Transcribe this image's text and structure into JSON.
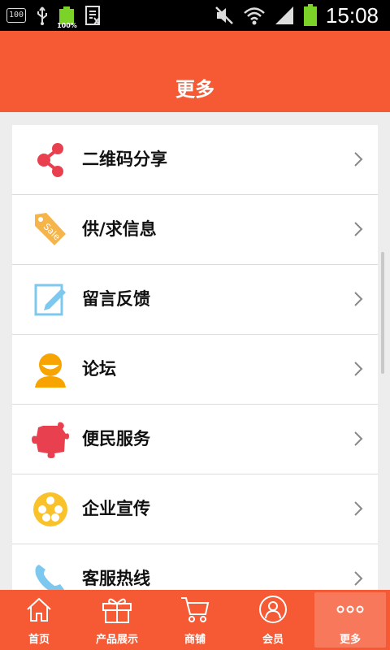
{
  "status_bar": {
    "notif_box": "100",
    "battery_small_pct": "100%",
    "time": "15:08"
  },
  "header": {
    "title": "更多"
  },
  "menu": {
    "items": [
      {
        "label": "二维码分享",
        "icon": "share-icon"
      },
      {
        "label": "供/求信息",
        "icon": "sale-tag-icon",
        "icon_text": "Sale"
      },
      {
        "label": "留言反馈",
        "icon": "edit-note-icon"
      },
      {
        "label": "论坛",
        "icon": "user-avatar-icon"
      },
      {
        "label": "便民服务",
        "icon": "puzzle-icon"
      },
      {
        "label": "企业宣传",
        "icon": "film-reel-icon"
      },
      {
        "label": "客服热线",
        "icon": "phone-icon"
      }
    ]
  },
  "tabbar": {
    "items": [
      {
        "label": "首页",
        "icon": "home-icon"
      },
      {
        "label": "产品展示",
        "icon": "gift-icon"
      },
      {
        "label": "商铺",
        "icon": "cart-icon"
      },
      {
        "label": "会员",
        "icon": "member-icon"
      },
      {
        "label": "更多",
        "icon": "more-dots-icon",
        "active": true
      }
    ]
  },
  "colors": {
    "accent": "#f55a35",
    "active_tab": "#f7785a",
    "share": "#e8404f",
    "sale": "#f6b54a",
    "edit": "#7cc8ee",
    "avatar": "#f8a400",
    "puzzle": "#e8404f",
    "film": "#f9c22b",
    "phone": "#7cc8ee"
  }
}
